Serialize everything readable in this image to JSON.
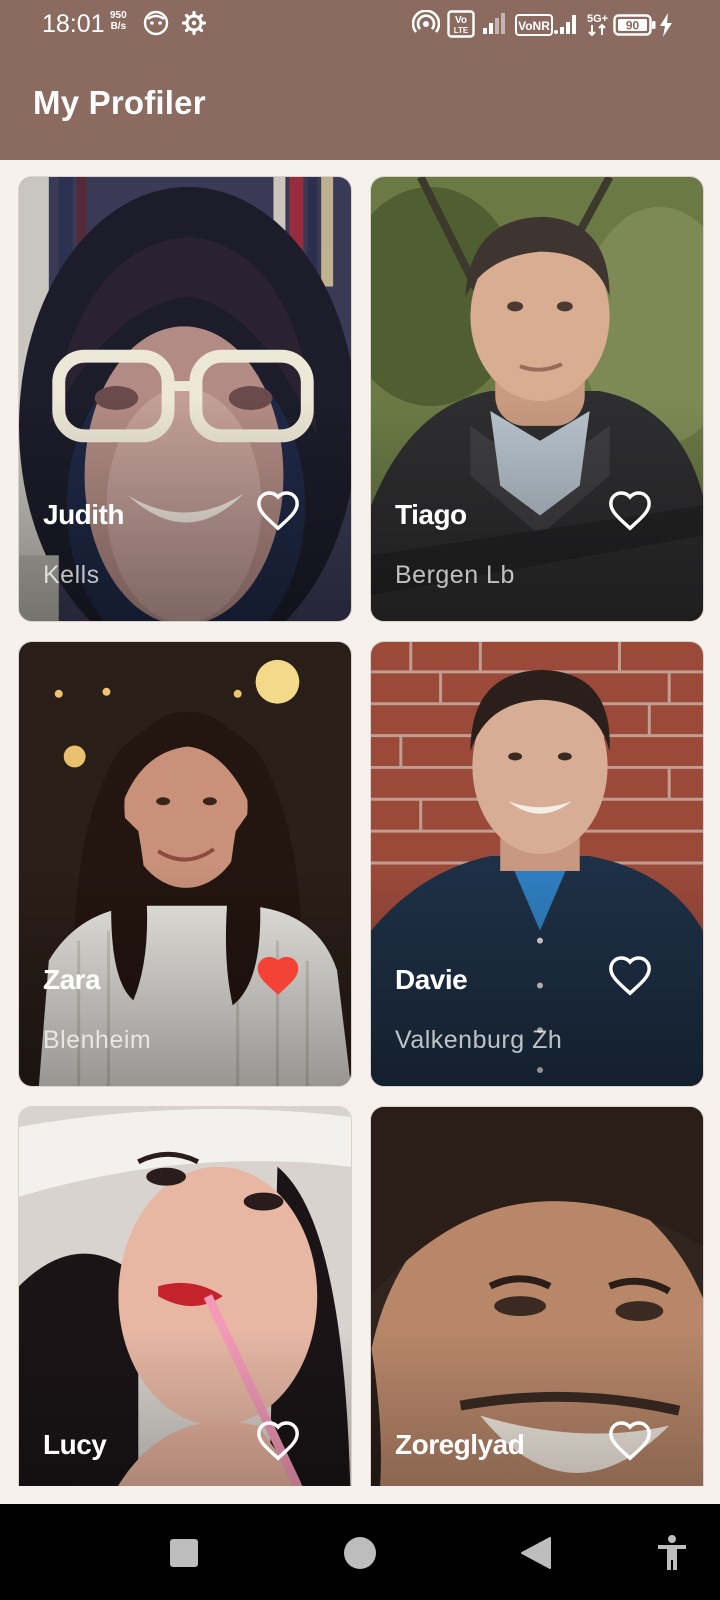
{
  "status_bar": {
    "time": "18:01",
    "net_speed_value": "950",
    "net_speed_unit": "B/s",
    "battery": "90",
    "icons": [
      "face-icon",
      "gear-icon",
      "hotspot-icon",
      "volte-icon",
      "signal-icon",
      "vonr-icon",
      "signal-icon",
      "5g-icon",
      "battery-icon",
      "charging-icon"
    ]
  },
  "app_bar": {
    "title": "My Profiler"
  },
  "profiles": [
    {
      "name": "Judith",
      "place": "Kells",
      "favorite": false
    },
    {
      "name": "Tiago",
      "place": "Bergen Lb",
      "favorite": false
    },
    {
      "name": "Zara",
      "place": "Blenheim",
      "favorite": true
    },
    {
      "name": "Davie",
      "place": "Valkenburg Zh",
      "favorite": false
    },
    {
      "name": "Lucy",
      "place": "",
      "favorite": false
    },
    {
      "name": "Zoreglyad",
      "place": "",
      "favorite": false
    }
  ],
  "colors": {
    "app_bar": "#8b6b60",
    "background": "#f6f1ec",
    "favorite_on": "#f44336",
    "favorite_off": "#ffffff"
  },
  "nav_bar": {
    "buttons": [
      "recents-button",
      "home-button",
      "back-button",
      "accessibility-button"
    ]
  }
}
